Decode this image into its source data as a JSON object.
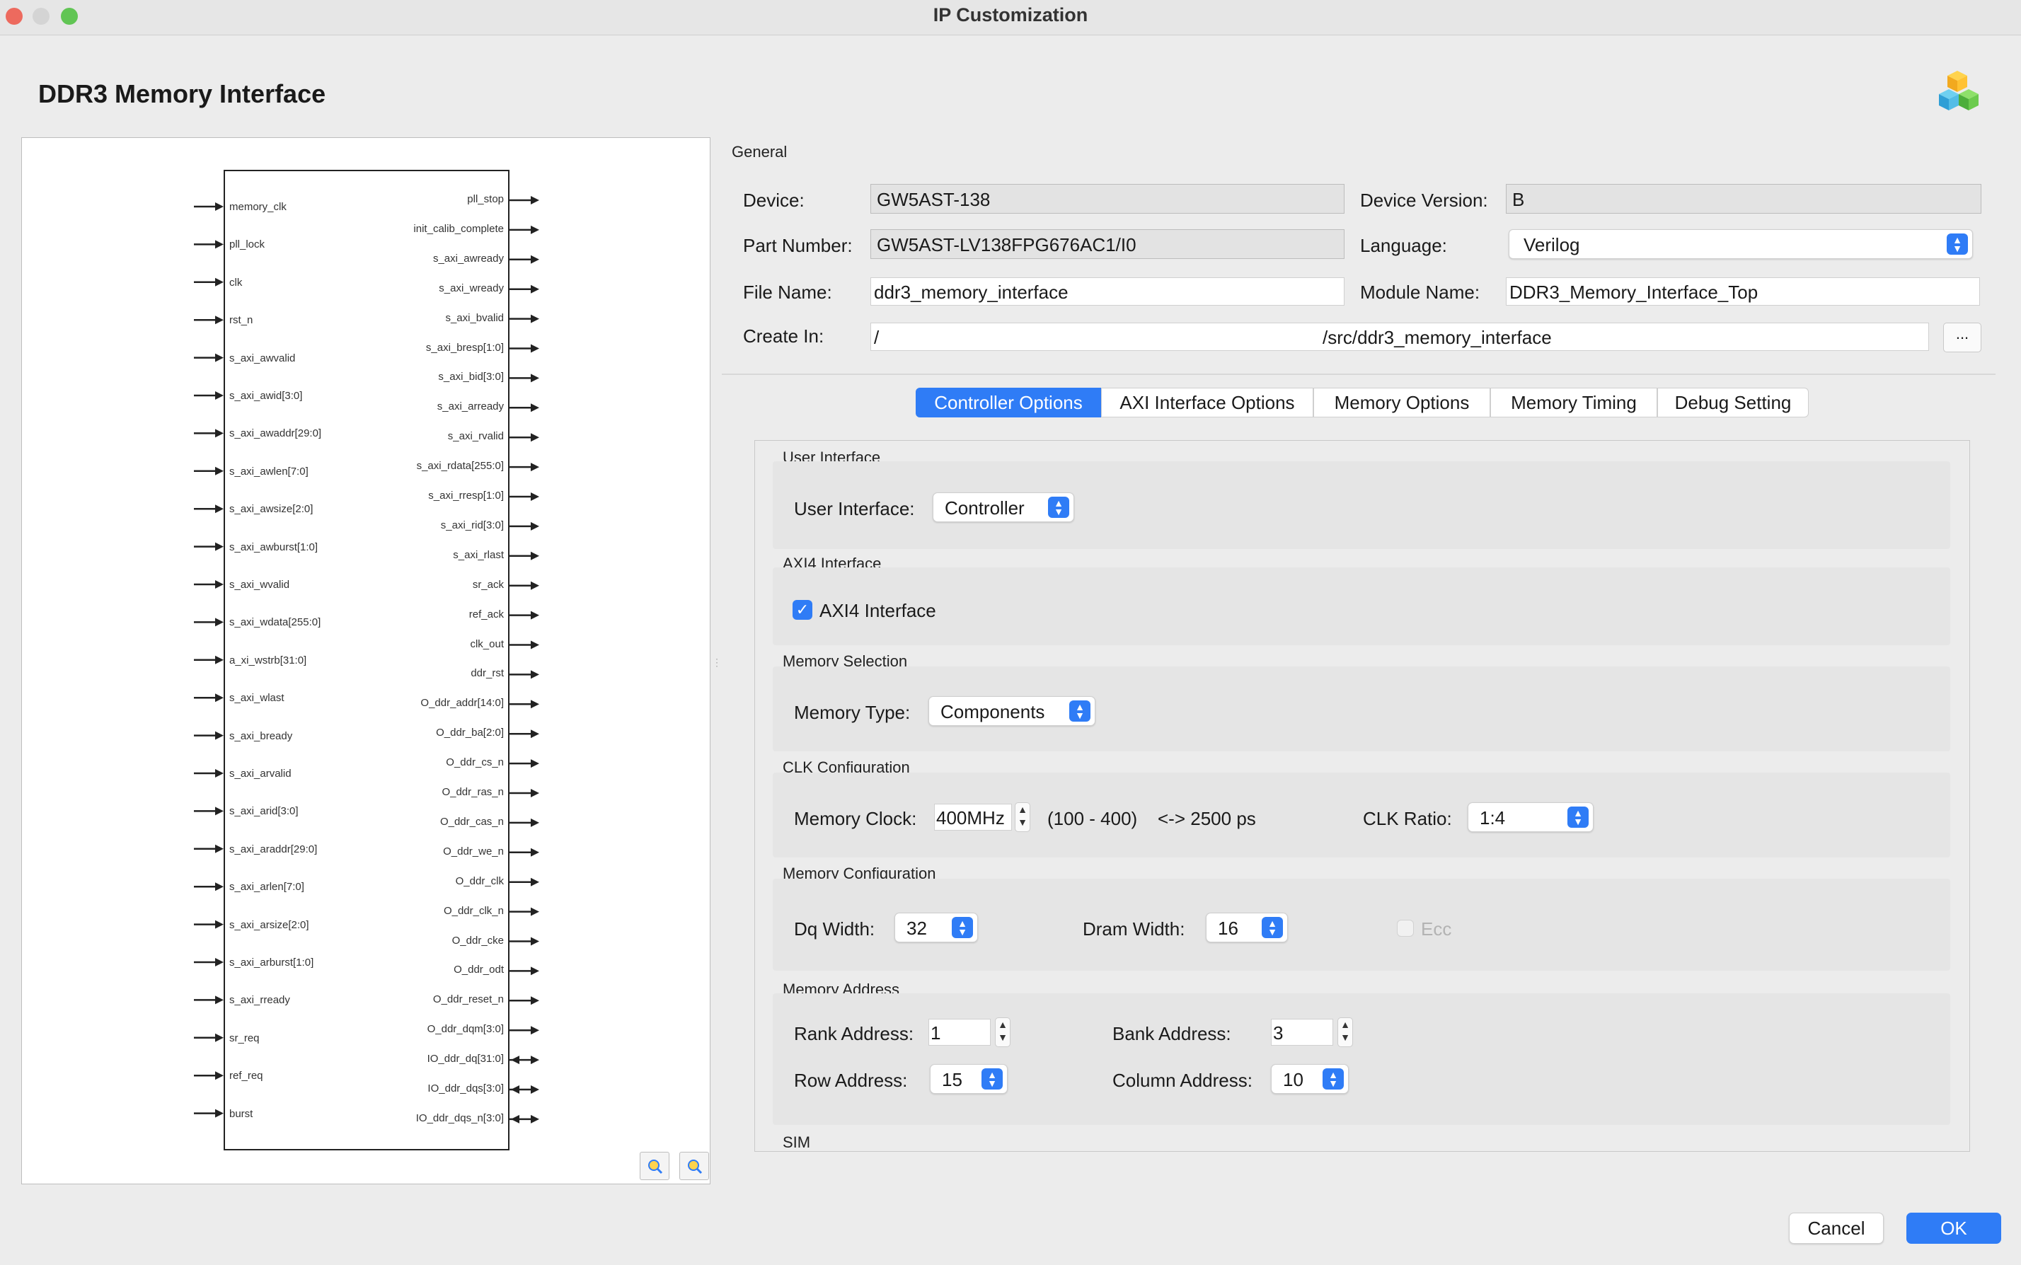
{
  "window": {
    "title": "IP Customization"
  },
  "page": {
    "title": "DDR3 Memory Interface"
  },
  "symbol": {
    "inputs": [
      "memory_clk",
      "pll_lock",
      "clk",
      "rst_n",
      "s_axi_awvalid",
      "s_axi_awid[3:0]",
      "s_axi_awaddr[29:0]",
      "s_axi_awlen[7:0]",
      "s_axi_awsize[2:0]",
      "s_axi_awburst[1:0]",
      "s_axi_wvalid",
      "s_axi_wdata[255:0]",
      "a_xi_wstrb[31:0]",
      "s_axi_wlast",
      "s_axi_bready",
      "s_axi_arvalid",
      "s_axi_arid[3:0]",
      "s_axi_araddr[29:0]",
      "s_axi_arlen[7:0]",
      "s_axi_arsize[2:0]",
      "s_axi_arburst[1:0]",
      "s_axi_rready",
      "sr_req",
      "ref_req",
      "burst"
    ],
    "outputs": [
      "pll_stop",
      "init_calib_complete",
      "s_axi_awready",
      "s_axi_wready",
      "s_axi_bvalid",
      "s_axi_bresp[1:0]",
      "s_axi_bid[3:0]",
      "s_axi_arready",
      "s_axi_rvalid",
      "s_axi_rdata[255:0]",
      "s_axi_rresp[1:0]",
      "s_axi_rid[3:0]",
      "s_axi_rlast",
      "sr_ack",
      "ref_ack",
      "clk_out",
      "ddr_rst",
      "O_ddr_addr[14:0]",
      "O_ddr_ba[2:0]",
      "O_ddr_cs_n",
      "O_ddr_ras_n",
      "O_ddr_cas_n",
      "O_ddr_we_n",
      "O_ddr_clk",
      "O_ddr_clk_n",
      "O_ddr_cke",
      "O_ddr_odt",
      "O_ddr_reset_n",
      "O_ddr_dqm[3:0]",
      "IO_ddr_dq[31:0]",
      "IO_ddr_dqs[3:0]",
      "IO_ddr_dqs_n[3:0]"
    ],
    "bidir_count": 3
  },
  "general": {
    "title": "General",
    "device_label": "Device:",
    "device_value": "GW5AST-138",
    "device_version_label": "Device Version:",
    "device_version_value": "B",
    "part_number_label": "Part Number:",
    "part_number_value": "GW5AST-LV138FPG676AC1/I0",
    "language_label": "Language:",
    "language_value": "Verilog",
    "file_name_label": "File Name:",
    "file_name_value": "ddr3_memory_interface",
    "module_name_label": "Module Name:",
    "module_name_value": "DDR3_Memory_Interface_Top",
    "create_in_label": "Create In:",
    "create_in_prefix": "/",
    "create_in_suffix": "/src/ddr3_memory_interface",
    "browse_label": "..."
  },
  "tabs": [
    {
      "label": "Controller Options",
      "active": true
    },
    {
      "label": "AXI Interface Options",
      "active": false
    },
    {
      "label": "Memory Options",
      "active": false
    },
    {
      "label": "Memory Timing",
      "active": false
    },
    {
      "label": "Debug Setting",
      "active": false
    }
  ],
  "controller": {
    "user_interface": {
      "title": "User Interface",
      "label": "User Interface:",
      "value": "Controller"
    },
    "axi4": {
      "title": "AXI4 Interface",
      "checkbox_label": "AXI4 Interface",
      "checked": true
    },
    "memory_selection": {
      "title": "Memory Selection",
      "label": "Memory Type:",
      "value": "Components"
    },
    "clk": {
      "title": "CLK Configuration",
      "memory_clock_label": "Memory Clock:",
      "memory_clock_value": "400MHz",
      "range": "(100 - 400)",
      "period": "<-> 2500 ps",
      "clk_ratio_label": "CLK Ratio:",
      "clk_ratio_value": "1:4"
    },
    "memory_config": {
      "title": "Memory Configuration",
      "dq_width_label": "Dq Width:",
      "dq_width_value": "32",
      "dram_width_label": "Dram Width:",
      "dram_width_value": "16",
      "ecc_label": "Ecc",
      "ecc_checked": false
    },
    "memory_address": {
      "title": "Memory Address",
      "rank_label": "Rank Address:",
      "rank_value": "1",
      "bank_label": "Bank Address:",
      "bank_value": "3",
      "row_label": "Row Address:",
      "row_value": "15",
      "column_label": "Column Address:",
      "column_value": "10"
    },
    "sim": {
      "title": "SIM"
    }
  },
  "buttons": {
    "cancel": "Cancel",
    "ok": "OK"
  },
  "colors": {
    "accent": "#2f7cf6",
    "close": "#ed6a5e",
    "minimize": "#d4d4d4",
    "zoom": "#61c554"
  }
}
